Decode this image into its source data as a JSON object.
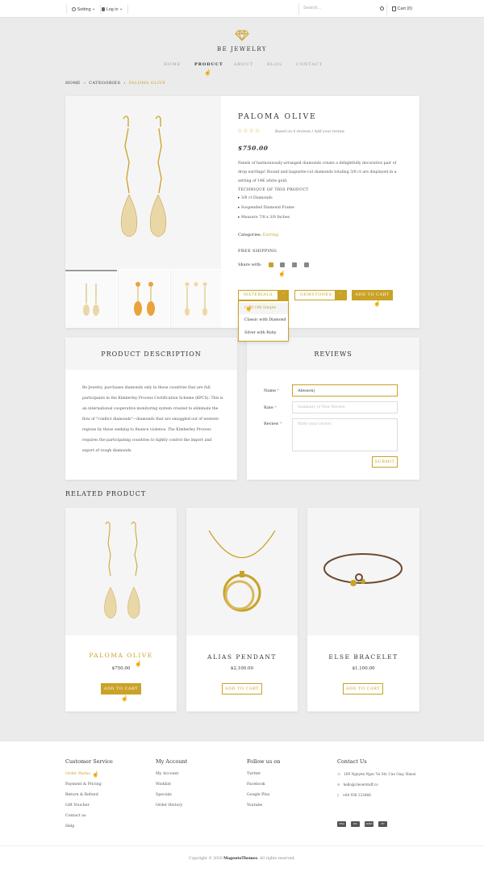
{
  "topbar": {
    "setting": "Setting",
    "login": "Log in",
    "search_placeholder": "Search...",
    "cart": "Cart (0)"
  },
  "brand": {
    "name": "BE JEWELRY"
  },
  "nav": [
    "HOME",
    "PRODUCT",
    "ABOUT",
    "BLOG",
    "CONTACT"
  ],
  "breadcrumb": [
    "HOME",
    "CATEGORIES",
    "PALOMA OLIVE"
  ],
  "product": {
    "title": "PALOMA OLIVE",
    "reviews_text": "Based on 4 reviews / Add your review",
    "price": "$750.00",
    "description": "Panels of harmoniously-arranged diamonds create a delightfully decorative pair of drop earrings! Round and baguette-cut diamonds totaling 3/8 ct are displayed in a setting of 14K white gold.",
    "technique_heading": "TECHNIQUE OF THIS PRODUCT",
    "techniques": [
      "3/8 ct Diamonds",
      "Suspended Diamond Frame",
      "Measure 7/8 x 3/8 Inches"
    ],
    "categories_label": "Categories:",
    "categories_value": "Earring",
    "shipping": "FREE SHIPPING",
    "share_label": "Share with:",
    "materials_label": "MATERIALS",
    "gemstones_label": "GEMSTONES",
    "add_to_cart": "ADD TO CART",
    "materials_options": [
      "Gold 18k Simple",
      "Classic with Diamond",
      "Silver with Ruby"
    ]
  },
  "description_panel": {
    "title": "PRODUCT DESCRIPTION",
    "body": "Be Jewelry, purchases diamonds only in those countries that are full participants in the Kimberley Process Certification Scheme (KPCS). This is an international cooperative monitoring system created to eliminate the flow of \"conflict diamonds\"—diamonds that are smuggled out of western regions by those seeking to finance violence. The Kimberley Process requires the participating countries to tightly control the import and export of rough diamonds."
  },
  "reviews_panel": {
    "title": "REVIEWS",
    "name_label": "Name",
    "name_value": "Alesson|",
    "rate_label": "Rate",
    "rate_placeholder": "Summary of Your Review",
    "review_label": "Review",
    "review_placeholder": "Write your review",
    "submit": "SUBMIT",
    "required_mark": "*"
  },
  "related": {
    "heading": "RELATED PRODUCT",
    "items": [
      {
        "name": "PALOMA OLIVE",
        "price": "$750.00",
        "button": "ADD TO CART"
      },
      {
        "name": "ALIAS PENDANT",
        "price": "$2,100.00",
        "button": "ADD TO CART"
      },
      {
        "name": "ELSE BRACELET",
        "price": "$1,100.00",
        "button": "ADD TO CART"
      }
    ]
  },
  "footer": {
    "columns": [
      {
        "title": "Customer Service",
        "links": [
          "Order Status",
          "Payment & Pricing",
          "Return & Refund",
          "Gift Voucher",
          "Contact us",
          "Help"
        ]
      },
      {
        "title": "My Account",
        "links": [
          "My Account",
          "Wishlist",
          "Specials",
          "Order History"
        ]
      },
      {
        "title": "Follow us on",
        "links": [
          "Twitter",
          "Facebook",
          "Google Plus",
          "Youtube"
        ]
      }
    ],
    "contact": {
      "title": "Contact Us",
      "address": "169 Nguyen Ngoc Vu Str, Cau Giay, Hanoi",
      "email": "hello@cleverstuff.co",
      "phone": "+84 938 123468"
    },
    "payments": [
      "VISA",
      "MC",
      "AMEX",
      "PP"
    ],
    "copyright_prefix": "Copyright © 2016",
    "copyright_brand": "MagentoThemes",
    "copyright_suffix": ". All rights reserved."
  },
  "colors": {
    "accent": "#c9a227",
    "bg": "#ebebeb"
  }
}
